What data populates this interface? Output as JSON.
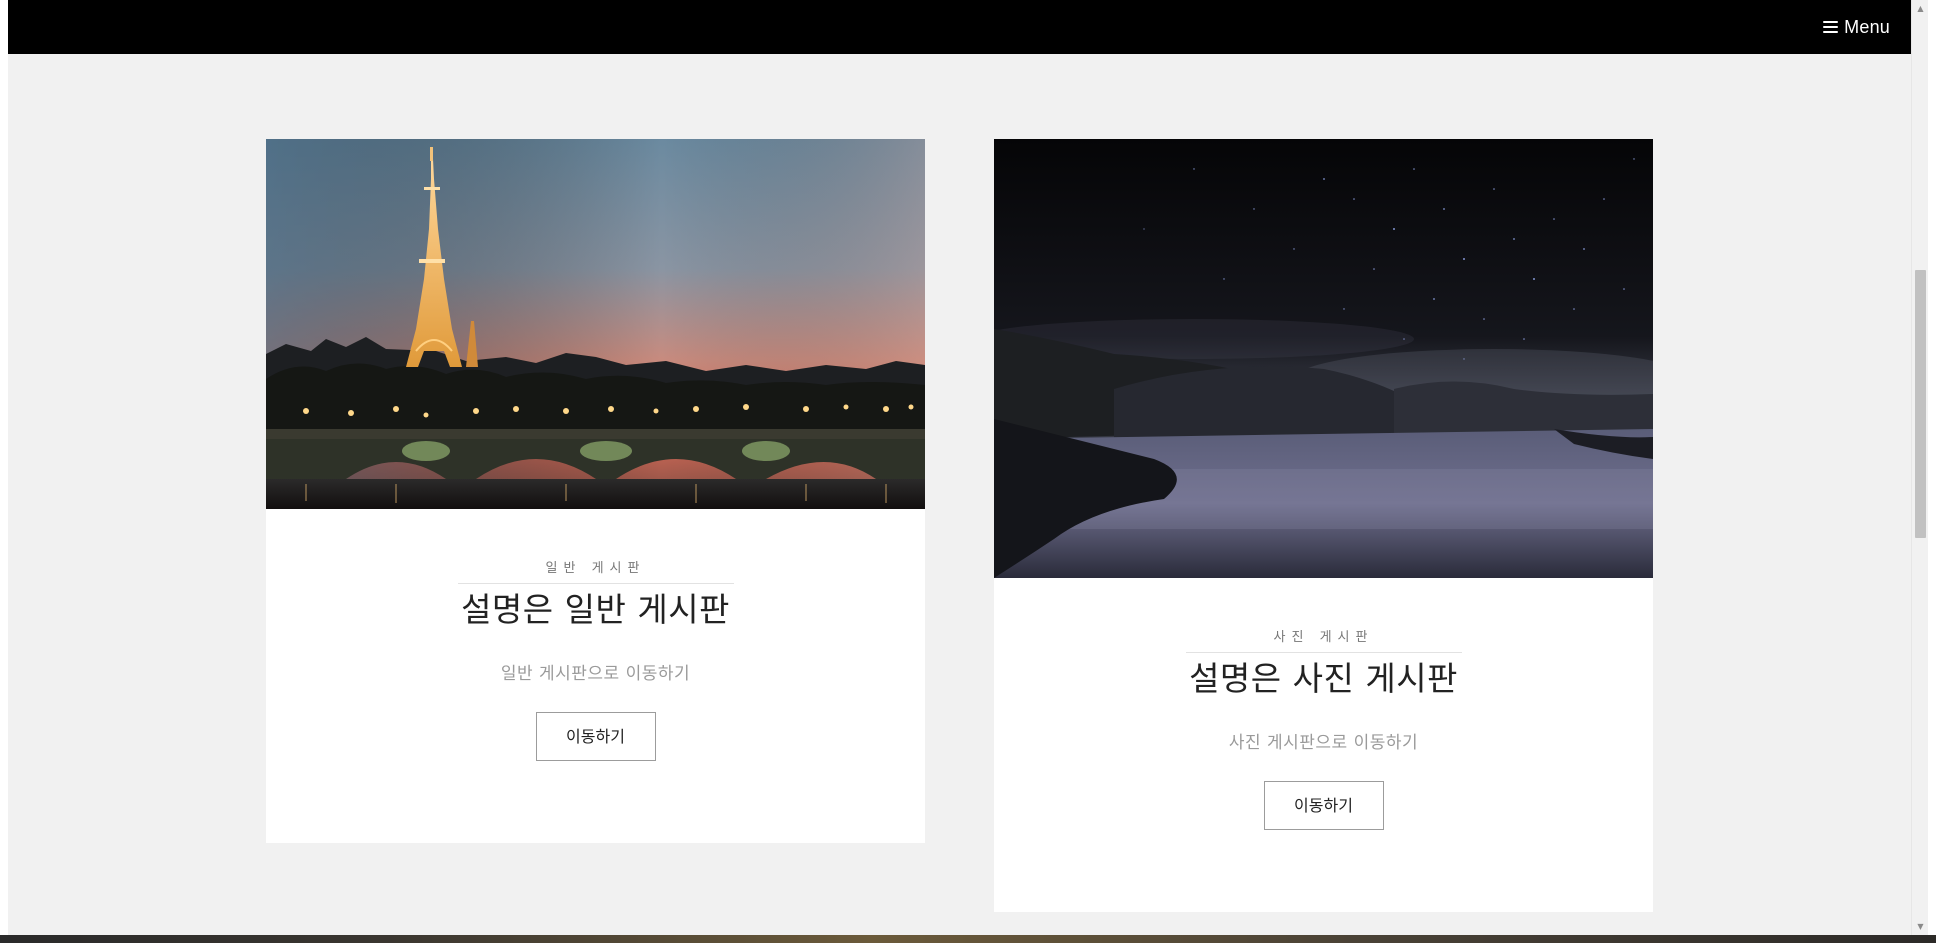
{
  "navbar": {
    "menu_label": "Menu",
    "menu_icon": "hamburger-icon"
  },
  "cards": [
    {
      "image_alt": "eiffel-tower-night-photo",
      "category": "일반 게시판",
      "title": "설명은 일반 게시판",
      "description": "일반 게시판으로 이동하기",
      "button_label": "이동하기"
    },
    {
      "image_alt": "starry-night-lake-photo",
      "category": "사진 게시판",
      "title": "설명은 사진 게시판",
      "description": "사진 게시판으로 이동하기",
      "button_label": "이동하기"
    }
  ],
  "colors": {
    "navbar_bg": "#000000",
    "page_bg": "#f1f1f1",
    "card_bg": "#ffffff"
  }
}
